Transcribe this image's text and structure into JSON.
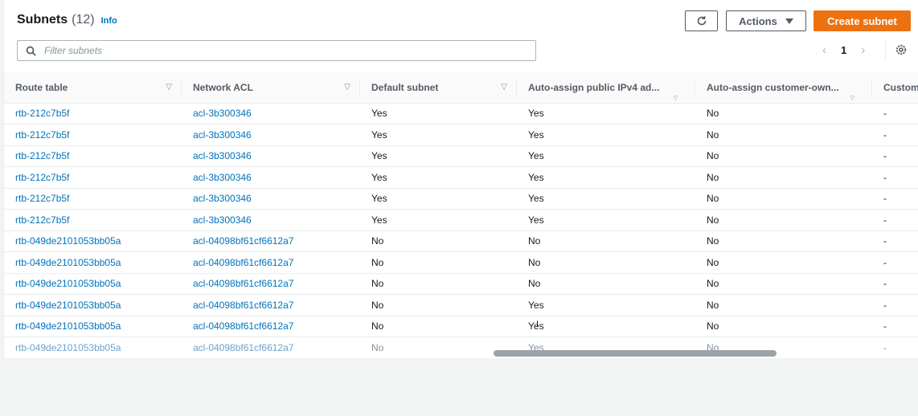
{
  "header": {
    "title": "Subnets",
    "count": "(12)",
    "info": "Info"
  },
  "toolbar": {
    "actions_label": "Actions",
    "create_label": "Create subnet"
  },
  "search": {
    "placeholder": "Filter subnets"
  },
  "pagination": {
    "current_page": "1"
  },
  "table": {
    "columns": [
      "Route table",
      "Network ACL",
      "Default subnet",
      "Auto-assign public IPv4 ad...",
      "Auto-assign customer-own...",
      "Custom"
    ],
    "rows": [
      [
        "rtb-212c7b5f",
        "acl-3b300346",
        "Yes",
        "Yes",
        "No",
        "-"
      ],
      [
        "rtb-212c7b5f",
        "acl-3b300346",
        "Yes",
        "Yes",
        "No",
        "-"
      ],
      [
        "rtb-212c7b5f",
        "acl-3b300346",
        "Yes",
        "Yes",
        "No",
        "-"
      ],
      [
        "rtb-212c7b5f",
        "acl-3b300346",
        "Yes",
        "Yes",
        "No",
        "-"
      ],
      [
        "rtb-212c7b5f",
        "acl-3b300346",
        "Yes",
        "Yes",
        "No",
        "-"
      ],
      [
        "rtb-212c7b5f",
        "acl-3b300346",
        "Yes",
        "Yes",
        "No",
        "-"
      ],
      [
        "rtb-049de2101053bb05a",
        "acl-04098bf61cf6612a7",
        "No",
        "No",
        "No",
        "-"
      ],
      [
        "rtb-049de2101053bb05a",
        "acl-04098bf61cf6612a7",
        "No",
        "No",
        "No",
        "-"
      ],
      [
        "rtb-049de2101053bb05a",
        "acl-04098bf61cf6612a7",
        "No",
        "No",
        "No",
        "-"
      ],
      [
        "rtb-049de2101053bb05a",
        "acl-04098bf61cf6612a7",
        "No",
        "Yes",
        "No",
        "-"
      ],
      [
        "rtb-049de2101053bb05a",
        "acl-04098bf61cf6612a7",
        "No",
        "Yes",
        "No",
        "-"
      ],
      [
        "rtb-049de2101053bb05a",
        "acl-04098bf61cf6612a7",
        "No",
        "Yes",
        "No",
        "-"
      ]
    ]
  },
  "colors": {
    "accent": "#ec7211",
    "link": "#0073bb",
    "text": "#16191f",
    "muted": "#545b64"
  },
  "icons": {
    "refresh": "refresh-icon",
    "caret": "caret-down-icon",
    "search": "search-icon",
    "settings": "gear-icon"
  }
}
